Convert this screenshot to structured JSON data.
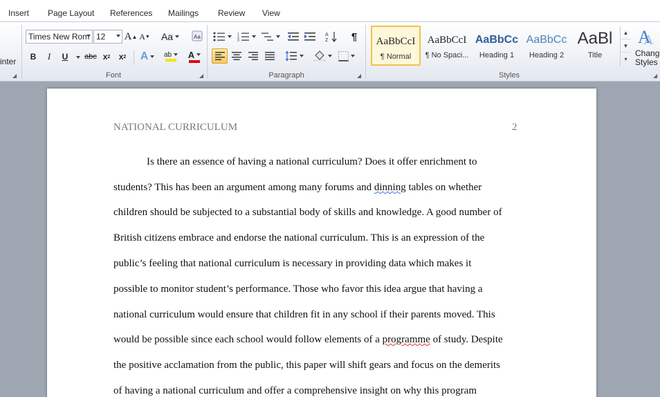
{
  "tabs": [
    "Insert",
    "Page Layout",
    "References",
    "Mailings",
    "Review",
    "View"
  ],
  "clipboard": {
    "label_fragment": "inter"
  },
  "font": {
    "group_label": "Font",
    "name": "Times New Rom",
    "size": "12",
    "grow_label": "A",
    "shrink_label": "A",
    "case_label": "Aa",
    "bold": "B",
    "italic": "I",
    "underline": "U",
    "strike": "abc",
    "subscript": "x",
    "superscript": "x",
    "effects": "A",
    "highlight": "ab",
    "color": "A",
    "highlight_color": "#f5e600",
    "font_color": "#e00000"
  },
  "paragraph": {
    "group_label": "Paragraph",
    "show_marks": "¶"
  },
  "styles": {
    "group_label": "Styles",
    "items": [
      {
        "sample": "AaBbCcI",
        "name": "¶ Normal",
        "selected": true
      },
      {
        "sample": "AaBbCcI",
        "name": "¶ No Spaci..."
      },
      {
        "sample": "AaBbCc",
        "name": "Heading 1"
      },
      {
        "sample": "AaBbCc",
        "name": "Heading 2"
      },
      {
        "sample": "AaBl",
        "name": "Title"
      }
    ],
    "change_styles_line1": "Change",
    "change_styles_line2": "Styles"
  },
  "document": {
    "header": "NATIONAL CURRICULUM",
    "page_number": "2",
    "lines": [
      {
        "indent": true,
        "text": "Is there an essence of having a national curriculum? Does it offer enrichment to"
      },
      {
        "parts": [
          "students? This has been an argument among many forums and ",
          "dinning",
          " tables on whether"
        ]
      },
      {
        "text": "children should be subjected to a substantial body of skills and knowledge. A good number of"
      },
      {
        "text": "British citizens embrace and endorse the national curriculum. This is an expression of the"
      },
      {
        "text": "public’s feeling that national curriculum is necessary in providing data which makes it"
      },
      {
        "text": "possible to monitor student’s performance. Those who favor this idea argue that having a"
      },
      {
        "text": "national curriculum would ensure that children fit in any school if their parents moved. This"
      },
      {
        "parts": [
          "would be possible since each school would follow elements of a ",
          "programme",
          " of study. Despite"
        ]
      },
      {
        "text": "the positive acclamation from the public, this paper will shift gears and focus on the demerits"
      },
      {
        "text": "of having a national curriculum and offer a comprehensive insight on why this program"
      }
    ]
  }
}
